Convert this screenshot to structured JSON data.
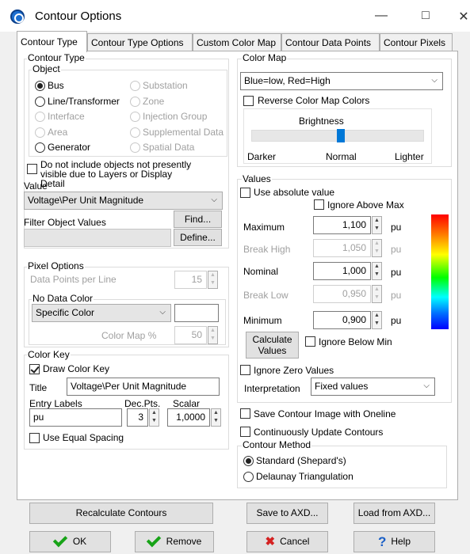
{
  "window": {
    "title": "Contour Options",
    "minimize": "—",
    "maximize": "□",
    "close": "✕"
  },
  "tabs": [
    "Contour Type",
    "Contour Type Options",
    "Custom Color Map",
    "Contour Data Points",
    "Contour Pixels"
  ],
  "contour_type": {
    "group_label": "Contour Type",
    "object_label": "Object",
    "objects": [
      "Bus",
      "Substation",
      "Line/Transformer",
      "Zone",
      "Interface",
      "Injection Group",
      "Area",
      "Supplemental Data",
      "Generator",
      "Spatial Data"
    ],
    "selected": "Bus",
    "not_include_label": "Do not include objects not presently visible due to Layers or Display Detail",
    "value_label": "Value",
    "value_selected": "Voltage\\Per Unit Magnitude",
    "filter_label": "Filter Object Values",
    "find_button": "Find...",
    "define_button": "Define..."
  },
  "pixel_options": {
    "group_label": "Pixel Options",
    "dp_label": "Data Points per Line",
    "dp_value": "15",
    "no_data_label": "No Data Color",
    "no_data_selected": "Specific Color",
    "color_map_pct_label": "Color Map %",
    "color_map_pct_value": "50"
  },
  "color_key": {
    "group_label": "Color Key",
    "draw_label": "Draw Color Key",
    "draw_checked": true,
    "title_label": "Title",
    "title_value": "Voltage\\Per Unit Magnitude",
    "entry_labels_label": "Entry Labels",
    "entry_labels_value": "pu",
    "dec_pts_label": "Dec.Pts.",
    "dec_pts_value": "3",
    "scalar_label": "Scalar",
    "scalar_value": "1,0000",
    "equal_spacing_label": "Use Equal Spacing"
  },
  "color_map": {
    "group_label": "Color Map",
    "selected": "Blue=low, Red=High",
    "reverse_label": "Reverse Color Map Colors",
    "brightness_label": "Brightness",
    "darker": "Darker",
    "normal": "Normal",
    "lighter": "Lighter",
    "brightness_level": 0.5,
    "gradient_colors": [
      "#ff0000",
      "#ff8000",
      "#ffff00",
      "#00ff00",
      "#00ffff",
      "#0070ff",
      "#0000ff"
    ]
  },
  "values": {
    "group_label": "Values",
    "absolute_label": "Use absolute value",
    "ignore_above_label": "Ignore Above Max",
    "unit": "pu",
    "maximum_label": "Maximum",
    "maximum_value": "1,100",
    "break_high_label": "Break High",
    "break_high_value": "1,050",
    "nominal_label": "Nominal",
    "nominal_value": "1,000",
    "break_low_label": "Break Low",
    "break_low_value": "0,950",
    "minimum_label": "Minimum",
    "minimum_value": "0,900",
    "calculate_button": "Calculate Values",
    "ignore_below_label": "Ignore Below Min",
    "ignore_zero_label": "Ignore Zero Values",
    "interpretation_label": "Interpretation",
    "interpretation_value": "Fixed values"
  },
  "options": {
    "save_image_label": "Save Contour Image with Oneline",
    "continuous_label": "Continuously Update Contours"
  },
  "method": {
    "group_label": "Contour Method",
    "standard": "Standard (Shepard's)",
    "delaunay": "Delaunay Triangulation"
  },
  "buttons": {
    "recalculate": "Recalculate Contours",
    "save_axd": "Save to AXD...",
    "load_axd": "Load from AXD...",
    "ok": "OK",
    "remove": "Remove",
    "cancel": "Cancel",
    "help": "Help"
  }
}
